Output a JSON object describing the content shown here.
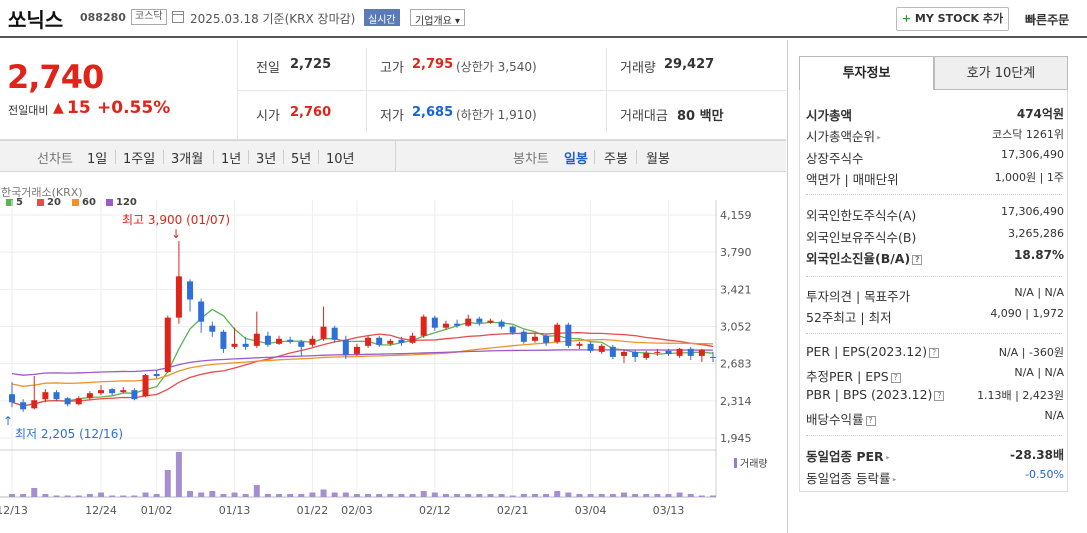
{
  "header": {
    "stock_name": "쏘닉스",
    "stock_code": "088280",
    "market": "코스닥",
    "date_text": "2025.03.18  기준(KRX 장마감)",
    "realtime_label": "실시간",
    "company_label": "기업개요 ▾",
    "mystock_label": "MY STOCK 추가",
    "quick_order_label": "빠른주문"
  },
  "price": {
    "current": "2,740",
    "change_label": "전일대비",
    "change_arrow": "▲",
    "change_value": "15",
    "change_pct": "+0.55%",
    "prev_label": "전일",
    "prev": "2,725",
    "open_label": "시가",
    "open": "2,760",
    "high_label": "고가",
    "high": "2,795",
    "upper_limit": "(상한가 3,540)",
    "low_label": "저가",
    "low": "2,685",
    "lower_limit": "(하한가 1,910)",
    "volume_label": "거래량",
    "volume": "29,427",
    "amount_label": "거래대금",
    "amount": "80 백만"
  },
  "period": {
    "line_label": "선차트",
    "line_tabs": [
      "1일",
      "1주일",
      "3개월",
      "1년",
      "3년",
      "5년",
      "10년"
    ],
    "candle_label": "봉차트",
    "candle_tabs": [
      "일봉",
      "주봉",
      "월봉"
    ],
    "selected": "일봉"
  },
  "chart": {
    "source": "한국거래소(KRX)",
    "ma_legend": [
      {
        "label": "5",
        "color": "#5ab552"
      },
      {
        "label": "20",
        "color": "#e84c4c"
      },
      {
        "label": "60",
        "color": "#f0922b"
      },
      {
        "label": "120",
        "color": "#9b59c9"
      }
    ],
    "max_label": "최고 3,900 (01/07)",
    "min_label": "최저 2,205 (12/16)",
    "volume_label": "거래량",
    "up_color": "#e0241a",
    "down_color": "#2f6fd8"
  },
  "chart_data": {
    "type": "candlestick",
    "ylim": [
      1945,
      4159
    ],
    "y_ticks": [
      "4,159",
      "3,790",
      "3,421",
      "3,052",
      "2,683",
      "2,314",
      "1,945"
    ],
    "x_ticks": [
      "12/13",
      "12/24",
      "01/02",
      "01/13",
      "01/22",
      "02/03",
      "02/12",
      "02/21",
      "03/04",
      "03/13"
    ],
    "x_tick_index": [
      0,
      8,
      13,
      20,
      27,
      31,
      38,
      45,
      52,
      59
    ],
    "candles": [
      [
        2380,
        2300,
        2500,
        2250
      ],
      [
        2300,
        2230,
        2330,
        2205
      ],
      [
        2240,
        2320,
        2560,
        2230
      ],
      [
        2330,
        2400,
        2430,
        2300
      ],
      [
        2400,
        2330,
        2420,
        2310
      ],
      [
        2340,
        2280,
        2350,
        2260
      ],
      [
        2280,
        2340,
        2360,
        2270
      ],
      [
        2340,
        2390,
        2410,
        2320
      ],
      [
        2390,
        2420,
        2470,
        2370
      ],
      [
        2430,
        2390,
        2440,
        2370
      ],
      [
        2400,
        2420,
        2450,
        2390
      ],
      [
        2420,
        2330,
        2440,
        2320
      ],
      [
        2360,
        2570,
        2580,
        2350
      ],
      [
        2580,
        2560,
        2620,
        2540
      ],
      [
        2600,
        3140,
        3160,
        2590
      ],
      [
        3140,
        3550,
        3900,
        3080
      ],
      [
        3500,
        3320,
        3520,
        3200
      ],
      [
        3300,
        3100,
        3330,
        2990
      ],
      [
        3060,
        3000,
        3100,
        2950
      ],
      [
        3000,
        2830,
        3020,
        2790
      ],
      [
        2850,
        2880,
        3040,
        2830
      ],
      [
        2880,
        2850,
        2950,
        2820
      ],
      [
        2860,
        2980,
        3200,
        2840
      ],
      [
        2960,
        2870,
        3000,
        2850
      ],
      [
        2880,
        2930,
        2960,
        2870
      ],
      [
        2920,
        2900,
        2950,
        2880
      ],
      [
        2900,
        2850,
        2920,
        2760
      ],
      [
        2870,
        2930,
        2960,
        2850
      ],
      [
        2930,
        3050,
        3250,
        2910
      ],
      [
        3040,
        2920,
        3060,
        2890
      ],
      [
        2920,
        2770,
        2960,
        2730
      ],
      [
        2780,
        2850,
        2880,
        2760
      ],
      [
        2860,
        2940,
        2960,
        2840
      ],
      [
        2940,
        2870,
        2960,
        2850
      ],
      [
        2880,
        2910,
        2930,
        2860
      ],
      [
        2920,
        2890,
        2950,
        2860
      ],
      [
        2890,
        2960,
        2990,
        2880
      ],
      [
        2960,
        3150,
        3170,
        2940
      ],
      [
        3140,
        3040,
        3160,
        3010
      ],
      [
        3040,
        3080,
        3110,
        3020
      ],
      [
        3080,
        3060,
        3120,
        3040
      ],
      [
        3060,
        3130,
        3170,
        3050
      ],
      [
        3130,
        3090,
        3150,
        3060
      ],
      [
        3090,
        3110,
        3130,
        3080
      ],
      [
        3100,
        3050,
        3120,
        3030
      ],
      [
        3050,
        2990,
        3060,
        2970
      ],
      [
        3000,
        2900,
        3020,
        2880
      ],
      [
        2910,
        2950,
        2980,
        2890
      ],
      [
        2960,
        2890,
        2980,
        2860
      ],
      [
        2900,
        3070,
        3090,
        2880
      ],
      [
        3070,
        2860,
        3090,
        2840
      ],
      [
        2860,
        2880,
        2900,
        2830
      ],
      [
        2880,
        2810,
        2900,
        2790
      ],
      [
        2800,
        2860,
        2880,
        2780
      ],
      [
        2850,
        2750,
        2870,
        2730
      ],
      [
        2760,
        2800,
        2820,
        2690
      ],
      [
        2800,
        2750,
        2820,
        2700
      ],
      [
        2740,
        2790,
        2810,
        2720
      ],
      [
        2790,
        2800,
        2830,
        2760
      ],
      [
        2810,
        2780,
        2830,
        2760
      ],
      [
        2760,
        2830,
        2840,
        2740
      ],
      [
        2830,
        2760,
        2850,
        2720
      ],
      [
        2760,
        2820,
        2830,
        2700
      ],
      [
        2750,
        2740,
        2800,
        2700
      ]
    ],
    "volume": [
      2,
      2,
      6,
      2,
      1,
      1,
      1,
      2,
      3,
      1,
      1,
      1,
      3,
      2,
      18,
      30,
      4,
      3,
      4,
      2,
      3,
      2,
      8,
      2,
      2,
      2,
      2,
      3,
      5,
      3,
      3,
      2,
      2,
      2,
      2,
      2,
      2,
      4,
      3,
      2,
      2,
      2,
      2,
      2,
      2,
      1,
      2,
      2,
      2,
      4,
      3,
      2,
      2,
      2,
      2,
      3,
      2,
      2,
      2,
      2,
      3,
      2,
      1,
      1
    ]
  },
  "invest": {
    "tab_invest": "투자정보",
    "tab_hoga": "호가 10단계",
    "rows": [
      {
        "k": "시가총액",
        "v": "474억원",
        "bold": true
      },
      {
        "k": "시가총액순위",
        "v": "코스닥 1261위",
        "tri": true
      },
      {
        "k": "상장주식수",
        "v": "17,306,490"
      },
      {
        "k": "액면가 | 매매단위",
        "v": "1,000원 | 1주"
      },
      {
        "k": "외국인한도주식수(A)",
        "v": "17,306,490"
      },
      {
        "k": "외국인보유주식수(B)",
        "v": "3,265,286"
      },
      {
        "k": "외국인소진율(B/A)",
        "v": "18.87%",
        "bold": true,
        "q": true
      },
      {
        "k": "투자의견 | 목표주가",
        "v": "N/A | N/A"
      },
      {
        "k": "52주최고 | 최저",
        "v": "4,090 | 1,972"
      },
      {
        "k": "PER | EPS(2023.12)",
        "v": "N/A | -360원",
        "q": true
      },
      {
        "k": "추정PER | EPS",
        "v": "N/A | N/A",
        "q": true
      },
      {
        "k": "PBR | BPS (2023.12)",
        "v": "1.13배 | 2,423원",
        "q": true
      },
      {
        "k": "배당수익률",
        "v": "N/A",
        "q": true
      },
      {
        "k": "동일업종 PER",
        "v": "-28.38배",
        "bold": true,
        "tri": true
      },
      {
        "k": "동일업종 등락률",
        "v": "-0.50%",
        "blue": true,
        "tri": true
      }
    ]
  }
}
